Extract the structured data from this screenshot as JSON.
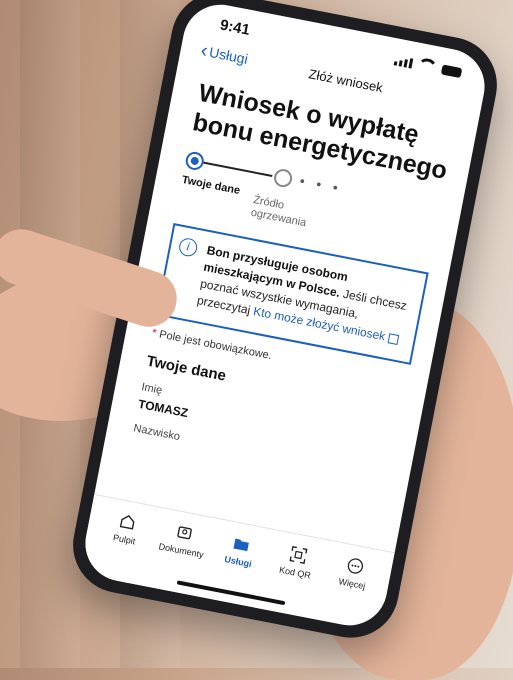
{
  "status_bar": {
    "time": "9:41"
  },
  "nav": {
    "back_label": "Usługi",
    "title": "Złóż wniosek"
  },
  "form": {
    "title_line1": "Wniosek o wypłatę",
    "title_line2": "bonu energetycznego",
    "steps": [
      {
        "label": "Twoje dane",
        "state": "active"
      },
      {
        "label_line1": "Źródło",
        "label_line2": "ogrzewania",
        "state": "pending"
      }
    ],
    "step_more": "• • •",
    "info": {
      "bold_text": "Bon przysługuje osobom mieszkającym w Polsce.",
      "text": " Jeśli chcesz poznać wszystkie wymagania, przeczytaj ",
      "link_text": "Kto może złożyć wniosek"
    },
    "required_star": "*",
    "required_note": " Pole jest obowiązkowe.",
    "section_title": "Twoje dane",
    "fields": [
      {
        "label": "Imię",
        "value": "TOMASZ"
      },
      {
        "label": "Nazwisko",
        "value": ""
      }
    ]
  },
  "tabbar": {
    "items": [
      {
        "label": "Pulpit",
        "icon": "home-icon",
        "active": false
      },
      {
        "label": "Dokumenty",
        "icon": "id-card-icon",
        "active": false
      },
      {
        "label": "Usługi",
        "icon": "folder-icon",
        "active": true
      },
      {
        "label": "Kod QR",
        "icon": "qr-code-icon",
        "active": false
      },
      {
        "label": "Więcej",
        "icon": "more-icon",
        "active": false
      }
    ]
  },
  "colors": {
    "accent": "#1b5fbf",
    "required": "#d0021b"
  }
}
